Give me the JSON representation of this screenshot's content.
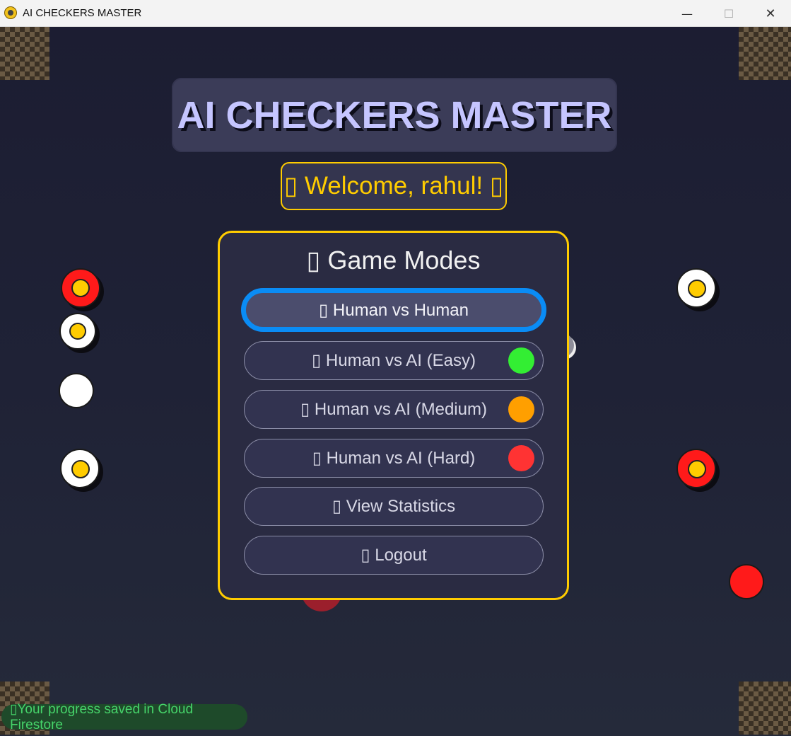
{
  "window": {
    "title": "AI CHECKERS MASTER",
    "minimize_glyph": "—",
    "maximize_glyph": "☐",
    "close_glyph": "✕"
  },
  "app": {
    "title": "AI CHECKERS MASTER",
    "welcome": "▯ Welcome, rahul! ▯",
    "modes_title": "▯ Game Modes",
    "modes": [
      {
        "label": "▯ Human vs Human",
        "selected": true
      },
      {
        "label": "▯ Human vs AI (Easy)",
        "indicator_color": "#33ee33"
      },
      {
        "label": "▯ Human vs AI (Medium)",
        "indicator_color": "#ff9f00"
      },
      {
        "label": "▯ Human vs AI (Hard)",
        "indicator_color": "#ff3333"
      },
      {
        "label": "▯ View Statistics"
      },
      {
        "label": "▯ Logout"
      }
    ],
    "status": "▯Your progress saved in Cloud Firestore"
  },
  "colors": {
    "accent": "#ffcc00",
    "selected_border": "#0a8cf5",
    "red_piece": "#ff2020",
    "white_piece": "#ffffff",
    "status_text": "#46d46a"
  }
}
